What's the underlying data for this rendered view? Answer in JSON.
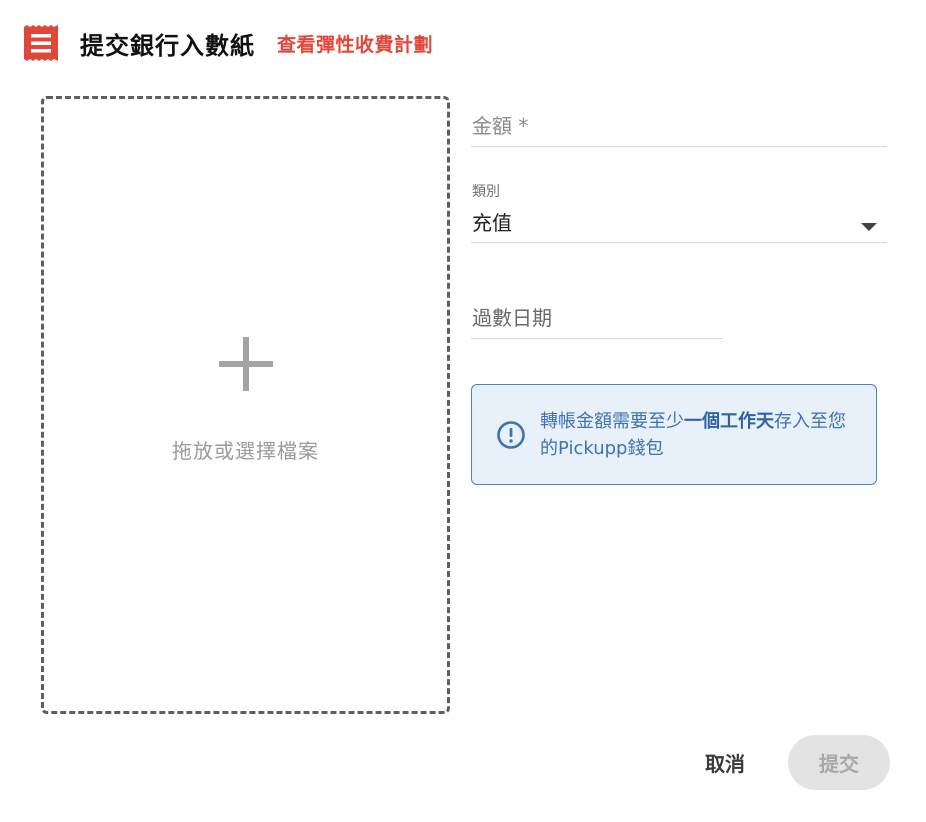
{
  "header": {
    "title": "提交銀行入數紙",
    "plan_link": "查看彈性收費計劃",
    "icon": "receipt-icon",
    "icon_color": "#e0473a"
  },
  "upload": {
    "icon": "plus-icon",
    "text": "拖放或選擇檔案"
  },
  "form": {
    "amount_placeholder": "金額 *",
    "category_label": "類別",
    "category_value": "充值",
    "date_placeholder": "過數日期"
  },
  "notice": {
    "icon": "info-icon",
    "text_before": "轉帳金額需要至少",
    "text_bold": "一個工作天",
    "text_after": "存入至您的Pickupp錢包",
    "color": "#3f72b0",
    "background": "#e8f0f9"
  },
  "actions": {
    "cancel_label": "取消",
    "submit_label": "提交"
  }
}
